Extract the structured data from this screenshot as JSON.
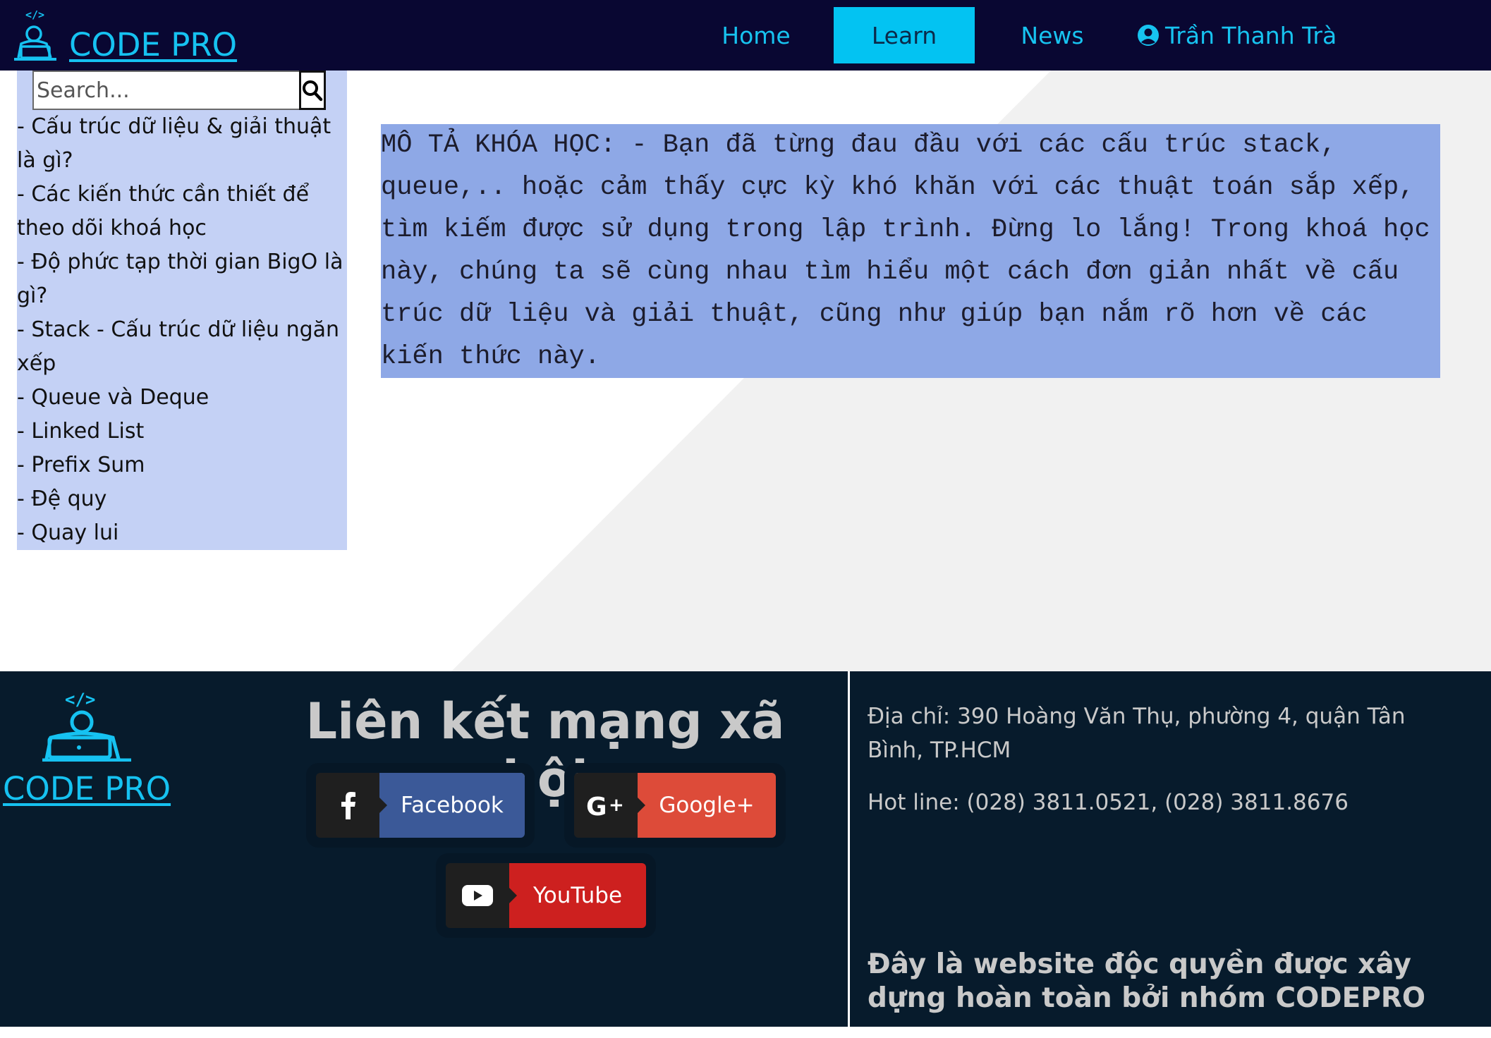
{
  "header": {
    "brand": "CODE PRO",
    "nav": [
      "Home",
      "Learn",
      "News"
    ],
    "user_name": "Trần Thanh Trà"
  },
  "search": {
    "placeholder": "Search..."
  },
  "sidebar": {
    "items": [
      "- Cấu trúc dữ liệu & giải thuật là gì?",
      "- Các kiến thức cần thiết để theo dõi khoá học",
      "- Độ phức tạp thời gian BigO là gì?",
      "- Stack - Cấu trúc dữ liệu ngăn xếp",
      "- Queue và Deque",
      "- Linked List",
      "- Prefix Sum",
      "- Đệ quy",
      "- Quay lui"
    ]
  },
  "course": {
    "description": "MÔ TẢ KHÓA HỌC: - Bạn đã từng đau đầu với các cấu trúc stack, queue,.. hoặc cảm thấy cực kỳ khó khăn với các thuật toán sắp xếp, tìm kiếm được sử dụng trong lập trình. Đừng lo lắng! Trong khoá học này, chúng ta sẽ cùng nhau tìm hiểu một cách đơn giản nhất về cấu trúc dữ liệu và giải thuật, cũng như giúp bạn nắm rõ hơn về các kiến thức này."
  },
  "footer": {
    "brand": "CODE PRO",
    "social_title": "Liên kết mạng xã hội",
    "social": [
      {
        "label": "Facebook",
        "icon": "facebook-icon",
        "color": "#3b5998"
      },
      {
        "label": "Google+",
        "icon": "google-plus-icon",
        "color": "#dd4b39"
      },
      {
        "label": "YouTube",
        "icon": "youtube-icon",
        "color": "#cd201f"
      }
    ],
    "address": "Địa chỉ: 390 Hoàng Văn Thụ, phường 4, quận Tân Bình, TP.HCM",
    "hotline": "Hot line: (028) 3811.0521, (028) 3811.8676",
    "copyright": "Đây là website độc quyền được xây dựng hoàn toàn bởi nhóm CODEPRO"
  },
  "colors": {
    "header_bg": "#090732",
    "accent": "#16c2f1",
    "active_tab": "#03c3f2",
    "sidebar_bg": "#c4d1f5",
    "description_bg": "#8ea8e6",
    "footer_bg": "#071b2c"
  }
}
